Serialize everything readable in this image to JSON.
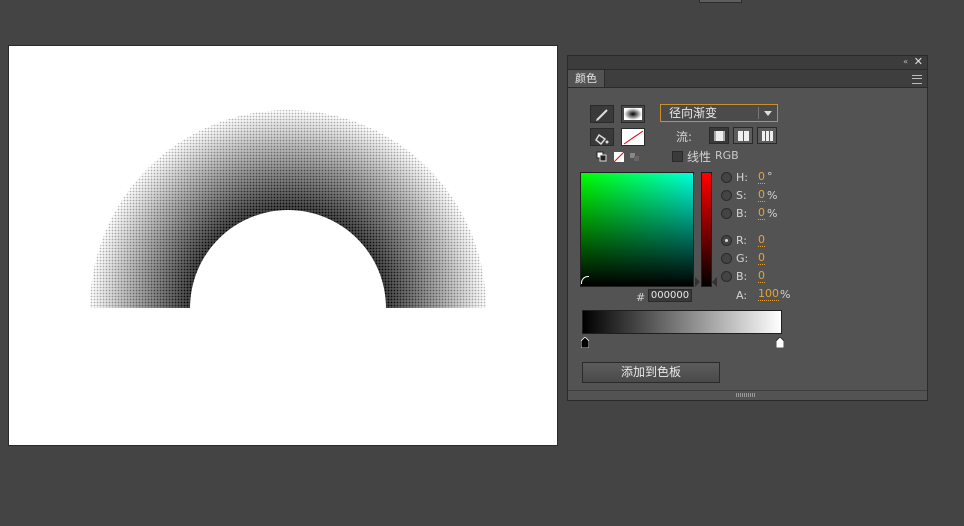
{
  "panel": {
    "tab_label": "颜色",
    "icons": {
      "collapse": "«",
      "close": "✕"
    }
  },
  "fill": {
    "type_selected": "径向渐变",
    "flow_label": "流:",
    "linear_label": "线性",
    "linear_checked": false,
    "rgb_label": "RGB"
  },
  "color": {
    "fields": [
      {
        "label": "H:",
        "value": "0",
        "unit": "°",
        "selected": false
      },
      {
        "label": "S:",
        "value": "0",
        "unit": "%",
        "selected": false
      },
      {
        "label": "B:",
        "value": "0",
        "unit": "%",
        "selected": false
      },
      {
        "label": "R:",
        "value": "0",
        "unit": "",
        "selected": true
      },
      {
        "label": "G:",
        "value": "0",
        "unit": "",
        "selected": false
      },
      {
        "label": "B:",
        "value": "0",
        "unit": "",
        "selected": false
      }
    ],
    "alpha": {
      "label": "A:",
      "value": "100",
      "unit": "%"
    },
    "hex_label": "#",
    "hex_value": "000000"
  },
  "gradient": {
    "stops": [
      {
        "color": "#000000",
        "position": 0
      },
      {
        "color": "#ffffff",
        "position": 1
      }
    ]
  },
  "add_swatch_label": "添加到色板",
  "colors": {
    "accent": "#e5a336",
    "panel_bg": "#535353",
    "app_bg": "#444444"
  }
}
